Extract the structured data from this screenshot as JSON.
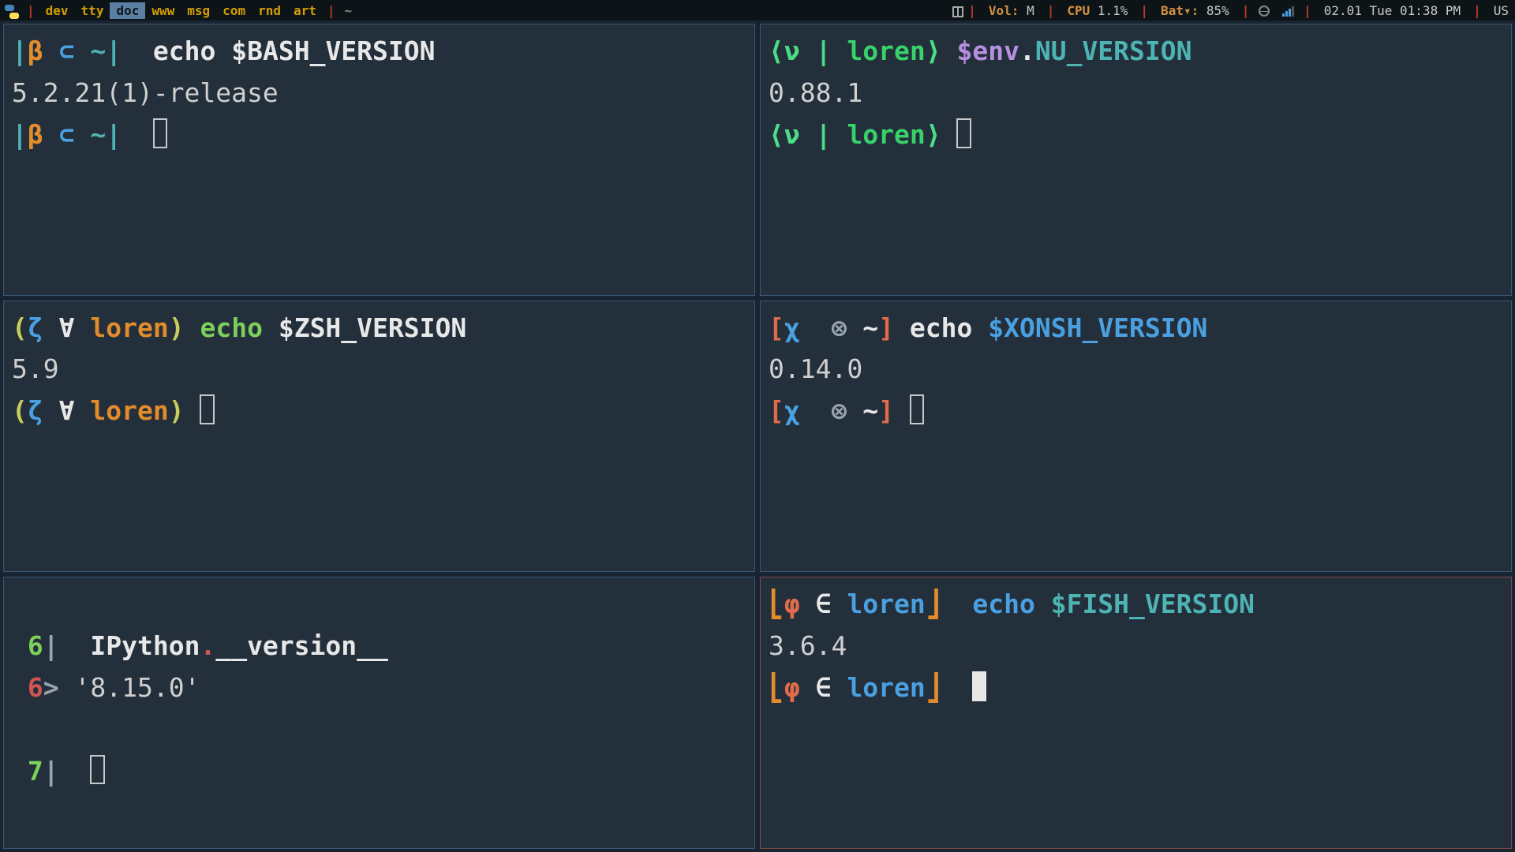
{
  "statusbar": {
    "workspaces": [
      "dev",
      "tty",
      "doc",
      "www",
      "msg",
      "com",
      "rnd",
      "art"
    ],
    "active_workspace": "doc",
    "window_title": "~",
    "vol_label": "Vol:",
    "vol_value": "M",
    "cpu_label": "CPU",
    "cpu_value": "1.1%",
    "bat_label": "Bat▾:",
    "bat_value": "85%",
    "clock": "02.01 Tue 01:38 PM",
    "kb_layout": "US"
  },
  "panes": {
    "bash": {
      "prompt": {
        "open": "|",
        "sym": "β",
        "op": "⊂",
        "path": "~",
        "close": "|"
      },
      "cmd_echo": "echo",
      "cmd_arg": "$BASH_VERSION",
      "output": "5.2.21(1)-release"
    },
    "nu": {
      "prompt": {
        "open": "⟨",
        "sym": "ν",
        "op": "|",
        "host": "loren",
        "close": "⟩"
      },
      "cmd_env": "$env",
      "cmd_dot": ".",
      "cmd_key": "NU_VERSION",
      "output": "0.88.1"
    },
    "zsh": {
      "prompt": {
        "open": "(",
        "sym": "ζ",
        "op": "∀",
        "host": "loren",
        "close": ")"
      },
      "cmd_echo": "echo",
      "cmd_arg": "$ZSH_VERSION",
      "output": "5.9"
    },
    "xonsh": {
      "prompt": {
        "open": "[",
        "sym": "χ",
        "op": "⊗",
        "path": "~",
        "close": "]"
      },
      "cmd_echo": "echo",
      "cmd_arg": "$XONSH_VERSION",
      "output": "0.14.0"
    },
    "ipython": {
      "in_num": "6",
      "in_mark": "|",
      "out_num": "6",
      "out_mark": ">",
      "next_num": "7",
      "cmd_obj": "IPython",
      "cmd_dot": ".",
      "cmd_attr": "__version__",
      "output": "'8.15.0'"
    },
    "fish": {
      "prompt": {
        "open": "⎣",
        "sym": "φ",
        "op": "∈",
        "host": "loren",
        "close": "⎦"
      },
      "cmd_echo": "echo",
      "cmd_arg": "$FISH_VERSION",
      "output": "3.6.4"
    }
  }
}
